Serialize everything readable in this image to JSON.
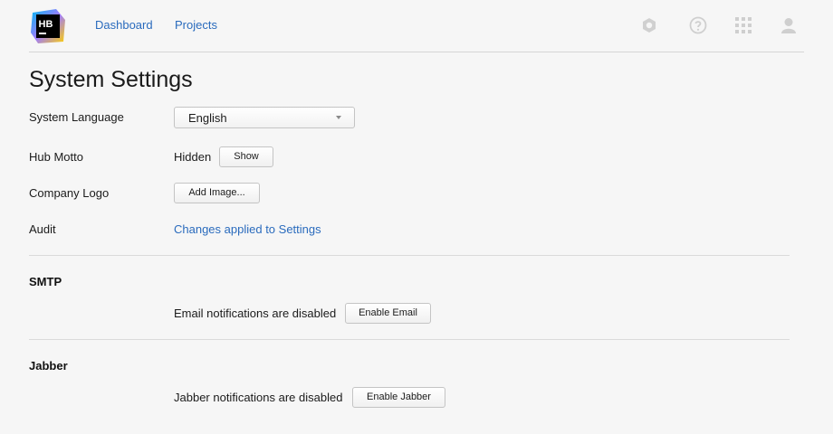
{
  "header": {
    "logo_text": "HB",
    "nav": [
      {
        "label": "Dashboard"
      },
      {
        "label": "Projects"
      }
    ],
    "icons": [
      "settings-icon",
      "help-icon",
      "apps-grid-icon",
      "user-icon"
    ]
  },
  "page": {
    "title": "System Settings"
  },
  "settings": {
    "language": {
      "label": "System Language",
      "value": "English"
    },
    "motto": {
      "label": "Hub Motto",
      "status": "Hidden",
      "button": "Show"
    },
    "logo": {
      "label": "Company Logo",
      "button": "Add Image..."
    },
    "audit": {
      "label": "Audit",
      "link": "Changes applied to Settings"
    }
  },
  "smtp": {
    "title": "SMTP",
    "status": "Email notifications are disabled",
    "button": "Enable Email"
  },
  "jabber": {
    "title": "Jabber",
    "status": "Jabber notifications are disabled",
    "button": "Enable Jabber"
  },
  "colors": {
    "link": "#2a6bbd",
    "background": "#f6f6f6",
    "divider": "#dadada"
  }
}
